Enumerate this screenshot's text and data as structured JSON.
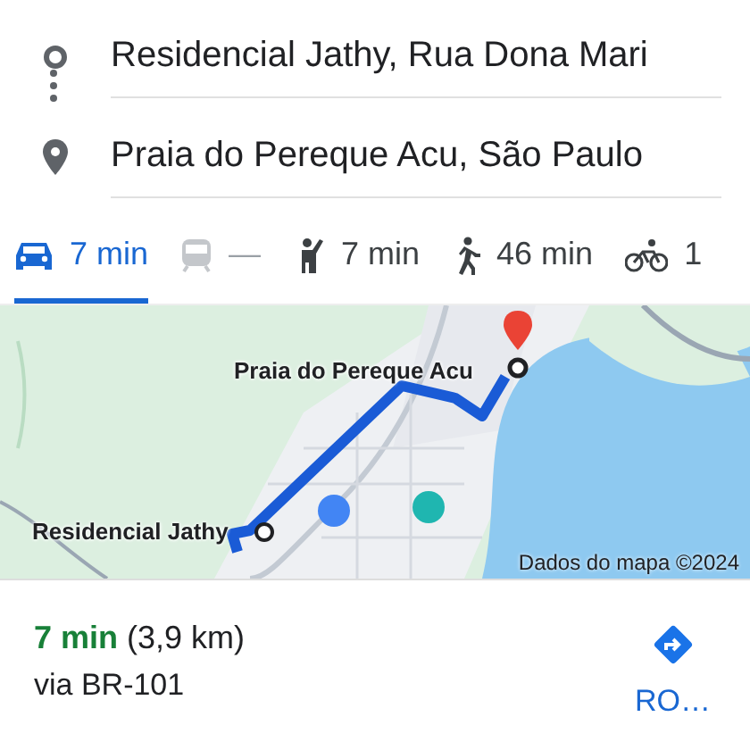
{
  "route": {
    "origin": "Residencial Jathy, Rua Dona Mari",
    "destination": "Praia do Pereque Acu, São Paulo"
  },
  "modes": [
    {
      "kind": "car",
      "label": "7 min",
      "selected": true,
      "disabled": false
    },
    {
      "kind": "transit",
      "label": "—",
      "selected": false,
      "disabled": true
    },
    {
      "kind": "ride",
      "label": "7 min",
      "selected": false,
      "disabled": false
    },
    {
      "kind": "walk",
      "label": "46 min",
      "selected": false,
      "disabled": false
    },
    {
      "kind": "bike",
      "label": "1",
      "selected": false,
      "disabled": false
    }
  ],
  "map": {
    "origin_label": "Residencial Jathy",
    "destination_label": "Praia do Pereque Acu",
    "attribution": "Dados do mapa ©2024"
  },
  "summary": {
    "headline": "**7 min** (3,9 km)",
    "via": "via BR-101",
    "action": "RO…"
  }
}
